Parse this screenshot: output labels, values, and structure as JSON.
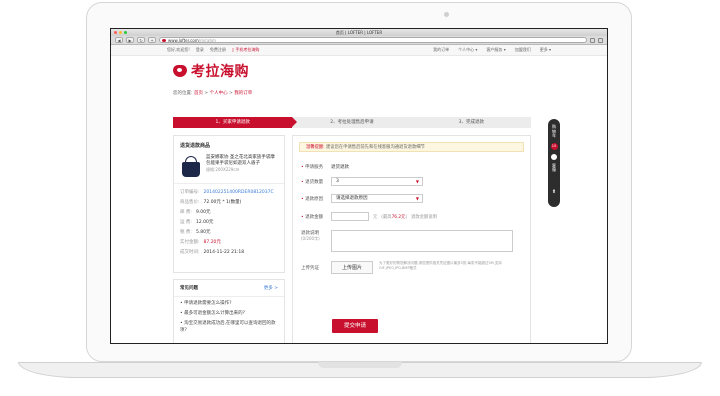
{
  "browser": {
    "window_title": "首页 | LOFTER | LOFTER",
    "url_domain": "www.lofter.com",
    "url_path": "/m/rahm"
  },
  "sitebar": {
    "left_items": [
      "您好,欢迎您!",
      "登录",
      "免费注册",
      "手机考拉海购"
    ],
    "right_items": [
      "我的订单",
      "个人中心 ▾",
      "客户服务 ▾",
      "加盟我们",
      "更多 ▾"
    ]
  },
  "logo": {
    "text": "考拉海购"
  },
  "breadcrumb": {
    "prefix": "您的位置:",
    "items": [
      "首页",
      "个人中心",
      "我的订单"
    ],
    "separator": " > "
  },
  "steps": [
    {
      "label": "1、买家申请退款",
      "active": true
    },
    {
      "label": "2、考拉处理售后申请",
      "active": false
    },
    {
      "label": "3、完成退款",
      "active": false
    }
  ],
  "product_panel": {
    "title": "退货退款商品",
    "product_name": "蓝安娜家协 圣之花北高家族手袋摩包能果手袋尼如遊双人盾子",
    "product_spec": "规格:200X229cm",
    "rows": [
      {
        "label": "订单编号:",
        "value": "201402251400RDER0812037C",
        "style": "blue"
      },
      {
        "label": "商品售价:",
        "value": "72.00元 * 1(数量)",
        "style": "normal"
      },
      {
        "label": "邮    费:",
        "value": "9.00元",
        "style": "normal"
      },
      {
        "label": "运    费:",
        "value": "12.00元",
        "style": "normal"
      },
      {
        "label": "税    费:",
        "value": "5.80元",
        "style": "normal"
      },
      {
        "label": "实付金额:",
        "value": "87.20元",
        "style": "red"
      },
      {
        "label": "成交时间:",
        "value": "2014-11-22  21:18",
        "style": "normal"
      }
    ]
  },
  "faq": {
    "title": "常见问题",
    "more": "更多 >",
    "items": [
      "• 申请退款需要怎么操作?",
      "• 最多可退金额怎么计算出来的?",
      "• 淘宝交易退款成功后,在哪里可以查询退回的款项?"
    ]
  },
  "form": {
    "notice_tip": "温馨提醒:",
    "notice_text": "建议您在申请售后前先和在线客服沟通退货退款细节",
    "service_label": "申请服务",
    "service_value": "退货退款",
    "quantity_label": "退货数量",
    "quantity_value": "3",
    "reason_label": "退款原因",
    "reason_value": "请选择退款原因",
    "amount_label": "退款金额",
    "amount_unit": "元",
    "amount_max_prefix": "(最高",
    "amount_max_value": "76.2元",
    "amount_max_suffix": ")",
    "amount_help": "退款金额说明",
    "desc_label": "退款说明",
    "desc_sub": "(0/200字)",
    "proof_label": "上传凭证",
    "upload_label": "上传图片",
    "upload_hint": "为了更好的帮您解决问题,请您提供相关凭证图片最多5张,每张不能超过5M,支持GIF,JPEG,JPG,BMP格式",
    "submit_label": "提交申请"
  },
  "rail": {
    "cart_text": "购物车",
    "cart_count": "10",
    "service_text": "客服"
  },
  "colors": {
    "brand": "#c8102e",
    "link": "#3a7bd5"
  }
}
